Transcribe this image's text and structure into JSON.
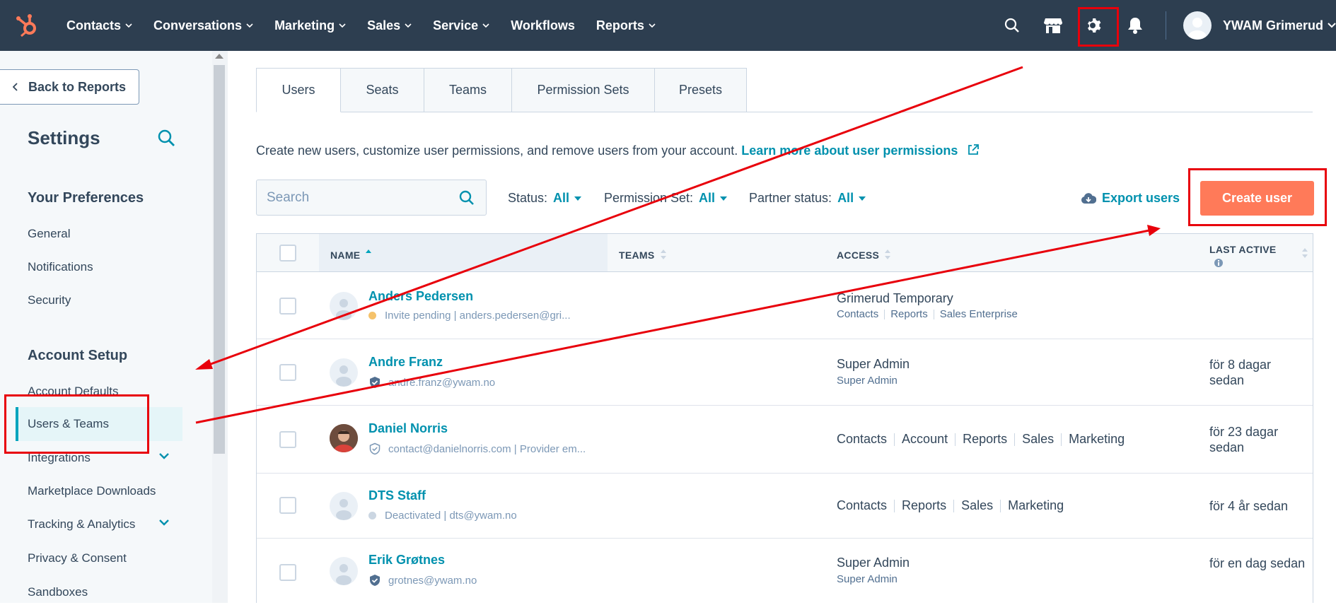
{
  "nav": {
    "items": [
      "Contacts",
      "Conversations",
      "Marketing",
      "Sales",
      "Service",
      "Workflows",
      "Reports"
    ],
    "has_chevron": [
      true,
      true,
      true,
      true,
      true,
      false,
      true
    ],
    "user_name": "YWAM Grimerud",
    "icons": [
      "hubspot-logo",
      "search-icon",
      "marketplace-icon",
      "gear-icon",
      "bell-icon",
      "avatar"
    ]
  },
  "sidebar": {
    "back_label": "Back to Reports",
    "title": "Settings",
    "section_preferences": "Your Preferences",
    "preferences": [
      "General",
      "Notifications",
      "Security"
    ],
    "section_account": "Account Setup",
    "account": [
      "Account Defaults",
      "Users & Teams",
      "Integrations",
      "Marketplace Downloads",
      "Tracking & Analytics",
      "Privacy & Consent",
      "Sandboxes"
    ],
    "active": "Users & Teams"
  },
  "tabs": [
    "Users",
    "Seats",
    "Teams",
    "Permission Sets",
    "Presets"
  ],
  "description": {
    "text": "Create new users, customize user permissions, and remove users from your account. ",
    "link": "Learn more about user permissions"
  },
  "search": {
    "placeholder": "Search",
    "value": ""
  },
  "filters": {
    "status_label": "Status:",
    "status_value": "All",
    "perm_label": "Permission Set:",
    "perm_value": "All",
    "partner_label": "Partner status:",
    "partner_value": "All"
  },
  "export_label": "Export users",
  "create_label": "Create user",
  "table": {
    "headers": {
      "name": "NAME",
      "teams": "TEAMS",
      "access": "ACCESS",
      "last_active": "LAST ACTIVE"
    },
    "rows": [
      {
        "name": "Anders Pedersen",
        "sub": "Invite pending | anders.pedersen@gri...",
        "status": "pending",
        "access_main": "Grimerud Temporary",
        "access_sub": [
          "Contacts",
          "Reports",
          "Sales Enterprise"
        ],
        "last_active": ""
      },
      {
        "name": "Andre Franz",
        "sub": "andre.franz@ywam.no",
        "status": "verified",
        "access_main": "Super Admin",
        "access_sub": [
          "Super Admin"
        ],
        "last_active": "för 8 dagar sedan"
      },
      {
        "name": "Daniel Norris",
        "sub": "contact@danielnorris.com | Provider em...",
        "status": "verified-outline",
        "access_inline": [
          "Contacts",
          "Account",
          "Reports",
          "Sales",
          "Marketing"
        ],
        "last_active": "för 23 dagar sedan"
      },
      {
        "name": "DTS Staff",
        "sub": "Deactivated | dts@ywam.no",
        "status": "deactivated",
        "access_inline": [
          "Contacts",
          "Reports",
          "Sales",
          "Marketing"
        ],
        "last_active": "för 4 år sedan"
      },
      {
        "name": "Erik Grøtnes",
        "sub": "grotnes@ywam.no",
        "status": "verified",
        "access_main": "Super Admin",
        "access_sub": [
          "Super Admin"
        ],
        "last_active": "för en dag sedan"
      }
    ]
  },
  "colors": {
    "nav_bg": "#2d3e50",
    "link": "#0091ae",
    "accent": "#ff7a59",
    "annotation": "#e8000b"
  }
}
